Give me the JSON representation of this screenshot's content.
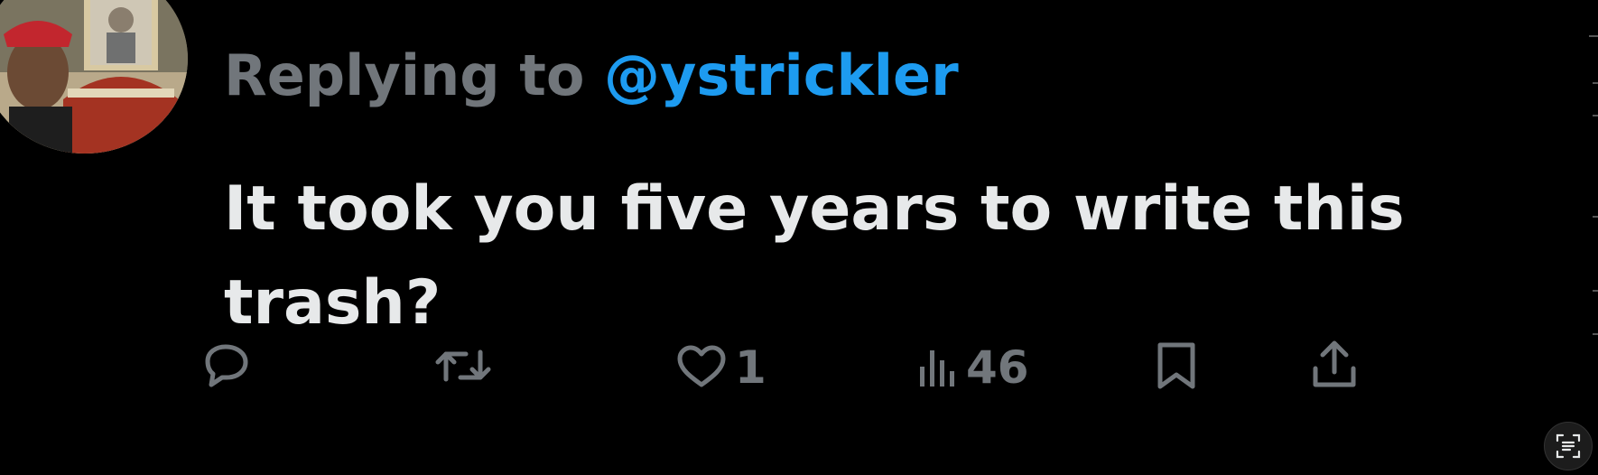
{
  "reply": {
    "prefix": "Replying to ",
    "handle": "@ystrickler"
  },
  "tweet": {
    "text": "It took you five years to write this trash?"
  },
  "actions": {
    "reply_count": "",
    "retweet_count": "",
    "like_count": "1",
    "views_count": "46"
  },
  "colors": {
    "background": "#000000",
    "text": "#e7e9ea",
    "muted": "#71767b",
    "accent": "#1d9bf0"
  },
  "icons": [
    "reply-icon",
    "retweet-icon",
    "like-icon",
    "views-icon",
    "bookmark-icon",
    "share-icon",
    "visual-lookup-icon"
  ]
}
